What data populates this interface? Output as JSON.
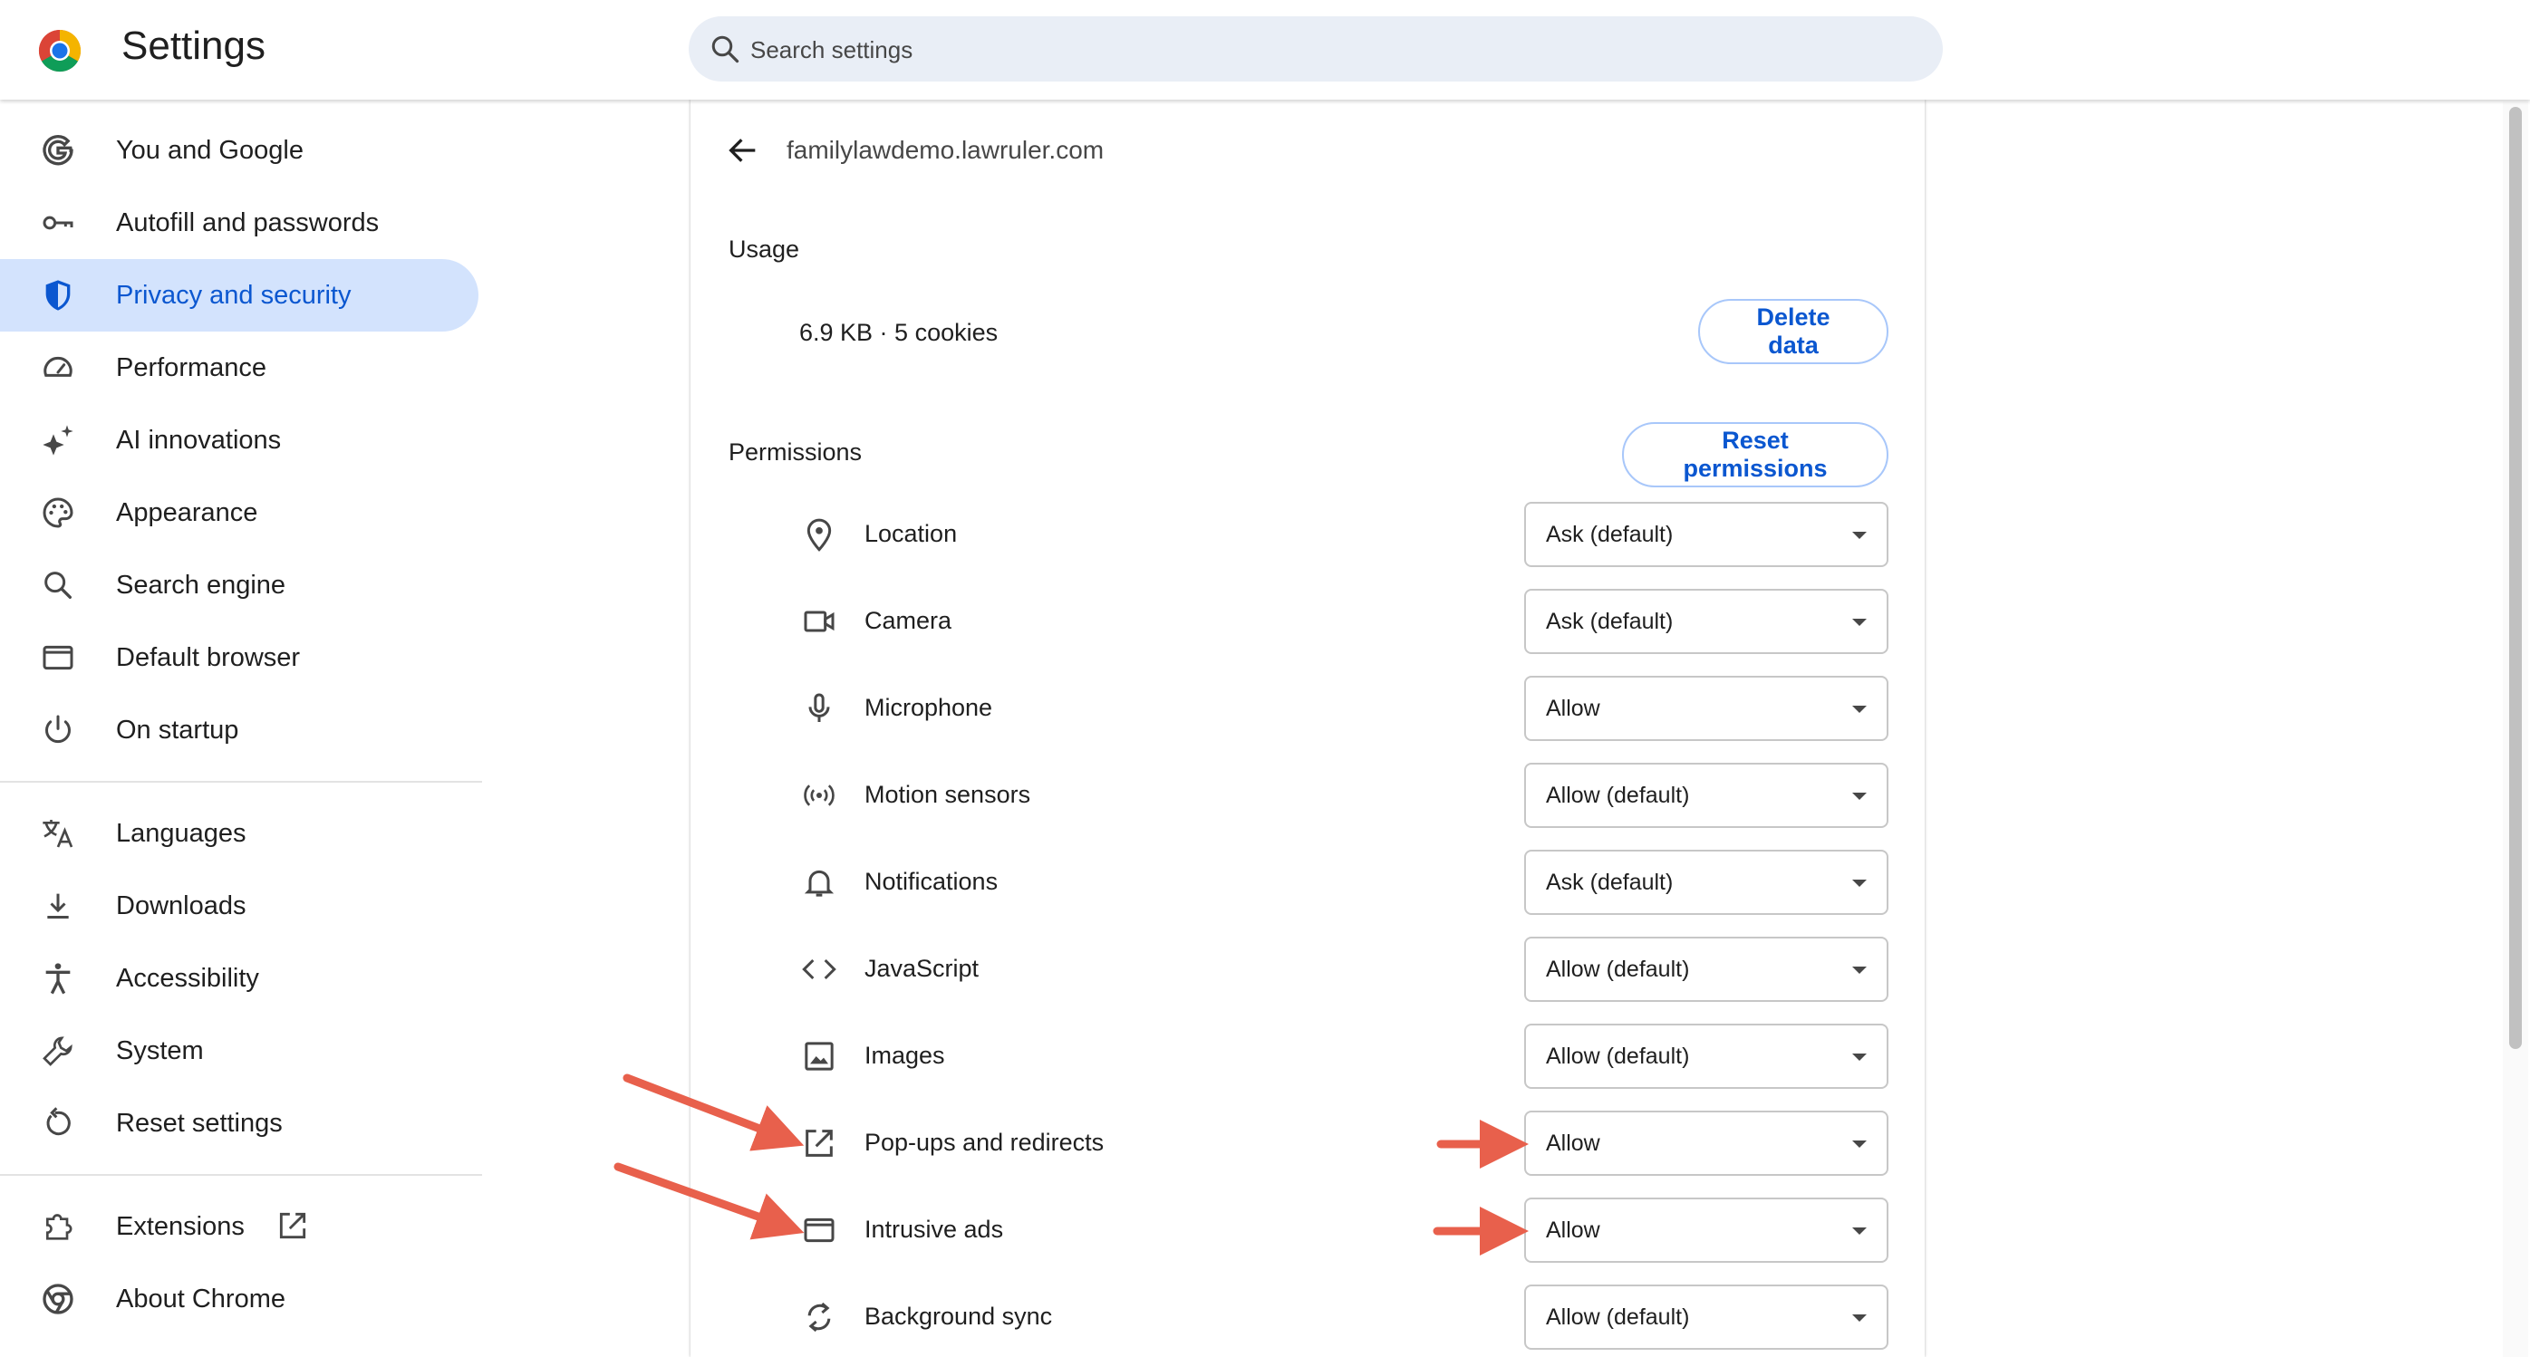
{
  "header": {
    "title": "Settings",
    "search_placeholder": "Search settings"
  },
  "sidebar": {
    "items": [
      {
        "label": "You and Google",
        "icon": "google-g-icon"
      },
      {
        "label": "Autofill and passwords",
        "icon": "key-icon"
      },
      {
        "label": "Privacy and security",
        "icon": "shield-icon",
        "active": true
      },
      {
        "label": "Performance",
        "icon": "speedometer-icon"
      },
      {
        "label": "AI innovations",
        "icon": "sparkle-icon"
      },
      {
        "label": "Appearance",
        "icon": "palette-icon"
      },
      {
        "label": "Search engine",
        "icon": "search-icon"
      },
      {
        "label": "Default browser",
        "icon": "browser-window-icon"
      },
      {
        "label": "On startup",
        "icon": "power-icon"
      },
      {
        "label": "Languages",
        "icon": "translate-icon"
      },
      {
        "label": "Downloads",
        "icon": "download-icon"
      },
      {
        "label": "Accessibility",
        "icon": "accessibility-icon"
      },
      {
        "label": "System",
        "icon": "wrench-icon"
      },
      {
        "label": "Reset settings",
        "icon": "reset-icon"
      },
      {
        "label": "Extensions",
        "icon": "puzzle-icon"
      },
      {
        "label": "About Chrome",
        "icon": "chrome-icon"
      }
    ]
  },
  "site": {
    "name": "familylawdemo.lawruler.com",
    "usage_label": "Usage",
    "usage_value": "6.9 KB · 5 cookies",
    "delete_label": "Delete data",
    "permissions_label": "Permissions",
    "reset_label": "Reset permissions"
  },
  "permissions": [
    {
      "label": "Location",
      "value": "Ask (default)",
      "icon": "location-pin-icon"
    },
    {
      "label": "Camera",
      "value": "Ask (default)",
      "icon": "camera-icon"
    },
    {
      "label": "Microphone",
      "value": "Allow",
      "icon": "microphone-icon"
    },
    {
      "label": "Motion sensors",
      "value": "Allow (default)",
      "icon": "motion-sensor-icon"
    },
    {
      "label": "Notifications",
      "value": "Ask (default)",
      "icon": "bell-icon"
    },
    {
      "label": "JavaScript",
      "value": "Allow (default)",
      "icon": "code-icon"
    },
    {
      "label": "Images",
      "value": "Allow (default)",
      "icon": "image-icon"
    },
    {
      "label": "Pop-ups and redirects",
      "value": "Allow",
      "icon": "open-external-icon"
    },
    {
      "label": "Intrusive ads",
      "value": "Allow",
      "icon": "ad-window-icon"
    },
    {
      "label": "Background sync",
      "value": "Allow (default)",
      "icon": "sync-icon"
    }
  ],
  "colors": {
    "accent": "#0b57d0",
    "active_bg": "#d3e3fd",
    "search_bg": "#e9eef6",
    "annotation_arrow": "#e8604c"
  }
}
